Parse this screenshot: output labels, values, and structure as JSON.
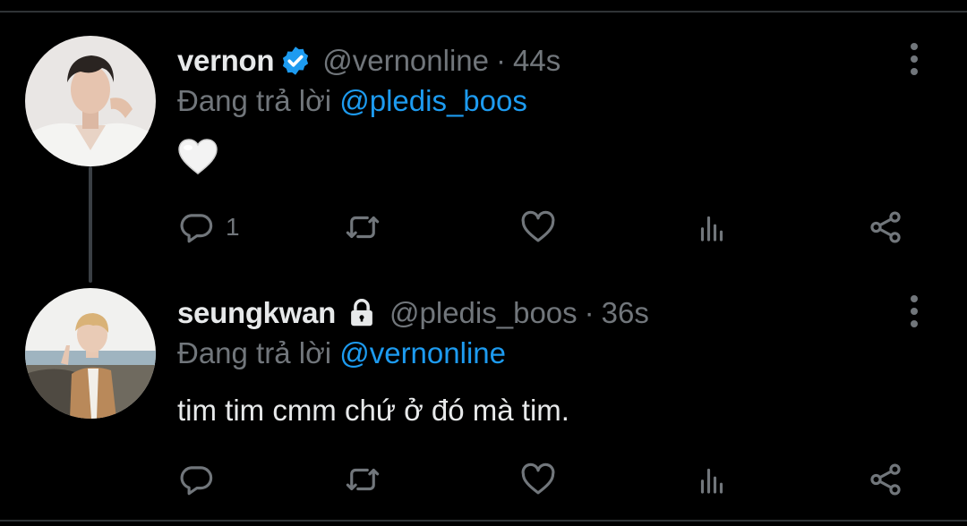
{
  "colors": {
    "background": "#000000",
    "text": "#e7e9ea",
    "muted": "#71767b",
    "accent": "#1d9bf0",
    "verified": "#1d9bf0"
  },
  "tweets": [
    {
      "display_name": "vernon",
      "verified": true,
      "handle": "@vernonline",
      "separator": "·",
      "time": "44s",
      "reply_prefix": "Đang trả lời",
      "reply_to": "@pledis_boos",
      "content_emoji": "white-heart",
      "reply_count": "1",
      "icons": [
        "reply-icon",
        "retweet-icon",
        "like-icon",
        "views-icon",
        "share-icon",
        "more-icon"
      ]
    },
    {
      "display_name": "seungkwan",
      "protected": true,
      "handle": "@pledis_boos",
      "separator": "·",
      "time": "36s",
      "reply_prefix": "Đang trả lời",
      "reply_to": "@vernonline",
      "text": "tim tim cmm chứ ở đó mà tim.",
      "icons": [
        "reply-icon",
        "retweet-icon",
        "like-icon",
        "views-icon",
        "share-icon",
        "more-icon"
      ]
    }
  ]
}
